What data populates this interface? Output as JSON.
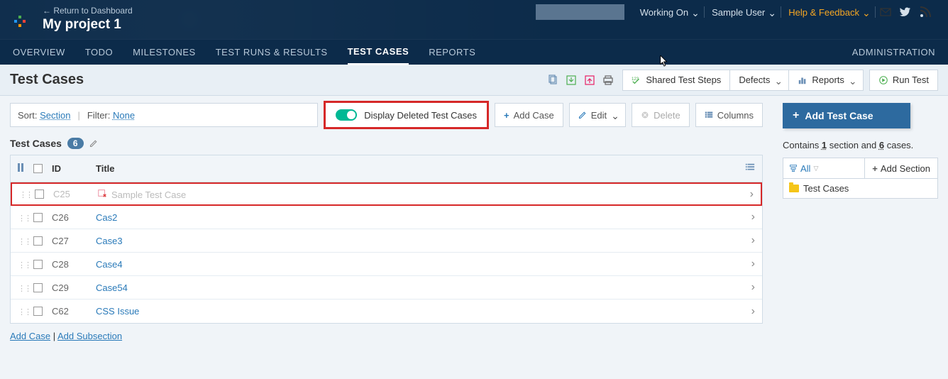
{
  "header": {
    "return_link": "← Return to Dashboard",
    "project_title": "My project 1",
    "working_on": "Working On",
    "user": "Sample User",
    "help": "Help & Feedback"
  },
  "nav": {
    "overview": "OVERVIEW",
    "todo": "TODO",
    "milestones": "MILESTONES",
    "runs": "TEST RUNS & RESULTS",
    "cases": "TEST CASES",
    "reports": "REPORTS",
    "admin": "ADMINISTRATION"
  },
  "toolbar": {
    "page_title": "Test Cases",
    "shared_steps": "Shared Test Steps",
    "defects": "Defects",
    "reports": "Reports",
    "run_test": "Run Test"
  },
  "filter": {
    "sort_label": "Sort:",
    "sort_value": "Section",
    "filter_label": "Filter:",
    "filter_value": "None",
    "toggle_label": "Display Deleted Test Cases",
    "add_case": "Add Case",
    "edit": "Edit",
    "delete": "Delete",
    "columns": "Columns"
  },
  "section": {
    "name": "Test Cases",
    "count": "6"
  },
  "table": {
    "hdr_id": "ID",
    "hdr_title": "Title",
    "rows": [
      {
        "id": "C25",
        "title": "Sample Test Case",
        "deleted": true
      },
      {
        "id": "C26",
        "title": "Cas2",
        "deleted": false
      },
      {
        "id": "C27",
        "title": "Case3",
        "deleted": false
      },
      {
        "id": "C28",
        "title": "Case4",
        "deleted": false
      },
      {
        "id": "C29",
        "title": "Case54",
        "deleted": false
      },
      {
        "id": "C62",
        "title": "CSS Issue",
        "deleted": false
      }
    ]
  },
  "bottom": {
    "add_case": "Add Case",
    "add_subsection": "Add Subsection"
  },
  "sidebar": {
    "add_btn": "Add Test Case",
    "contains_pre": "Contains ",
    "contains_sections": "1",
    "contains_mid": " section and ",
    "contains_cases": "6",
    "contains_post": " cases.",
    "all": "All",
    "add_section": "Add Section",
    "tree_item": "Test Cases"
  }
}
